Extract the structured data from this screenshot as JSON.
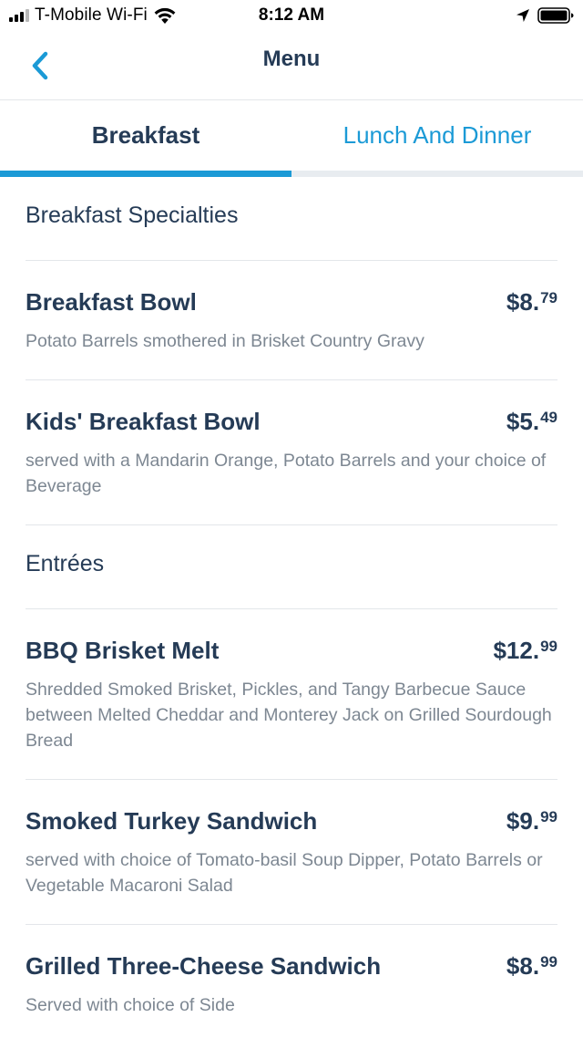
{
  "status_bar": {
    "carrier": "T-Mobile Wi-Fi",
    "time": "8:12 AM"
  },
  "nav": {
    "title": "Menu",
    "back_icon": "chevron-left-icon"
  },
  "tabs": [
    {
      "label": "Breakfast",
      "active": true
    },
    {
      "label": "Lunch And Dinner",
      "active": false
    }
  ],
  "colors": {
    "accent": "#1b9ad6",
    "text_primary": "#253b56",
    "text_secondary": "#7d8792",
    "divider": "#e3e6ea"
  },
  "sections": [
    {
      "title": "Breakfast Specialties",
      "items": [
        {
          "name": "Breakfast Bowl",
          "price_dollars": "$8.",
          "price_cents": "79",
          "description": "Potato Barrels smothered in Brisket Country Gravy"
        },
        {
          "name": "Kids' Breakfast Bowl",
          "price_dollars": "$5.",
          "price_cents": "49",
          "description": "served with a Mandarin Orange, Potato Barrels and your choice of Beverage"
        }
      ]
    },
    {
      "title": "Entrées",
      "items": [
        {
          "name": "BBQ Brisket Melt",
          "price_dollars": "$12.",
          "price_cents": "99",
          "description": "Shredded Smoked Brisket, Pickles, and Tangy Barbecue Sauce between Melted Cheddar and Monterey Jack on Grilled Sourdough Bread"
        },
        {
          "name": "Smoked Turkey Sandwich",
          "price_dollars": "$9.",
          "price_cents": "99",
          "description": "served with choice of Tomato-basil Soup Dipper, Potato Barrels or Vegetable Macaroni Salad"
        },
        {
          "name": "Grilled Three-Cheese Sandwich",
          "price_dollars": "$8.",
          "price_cents": "99",
          "description": "Served with choice of Side"
        }
      ]
    }
  ]
}
